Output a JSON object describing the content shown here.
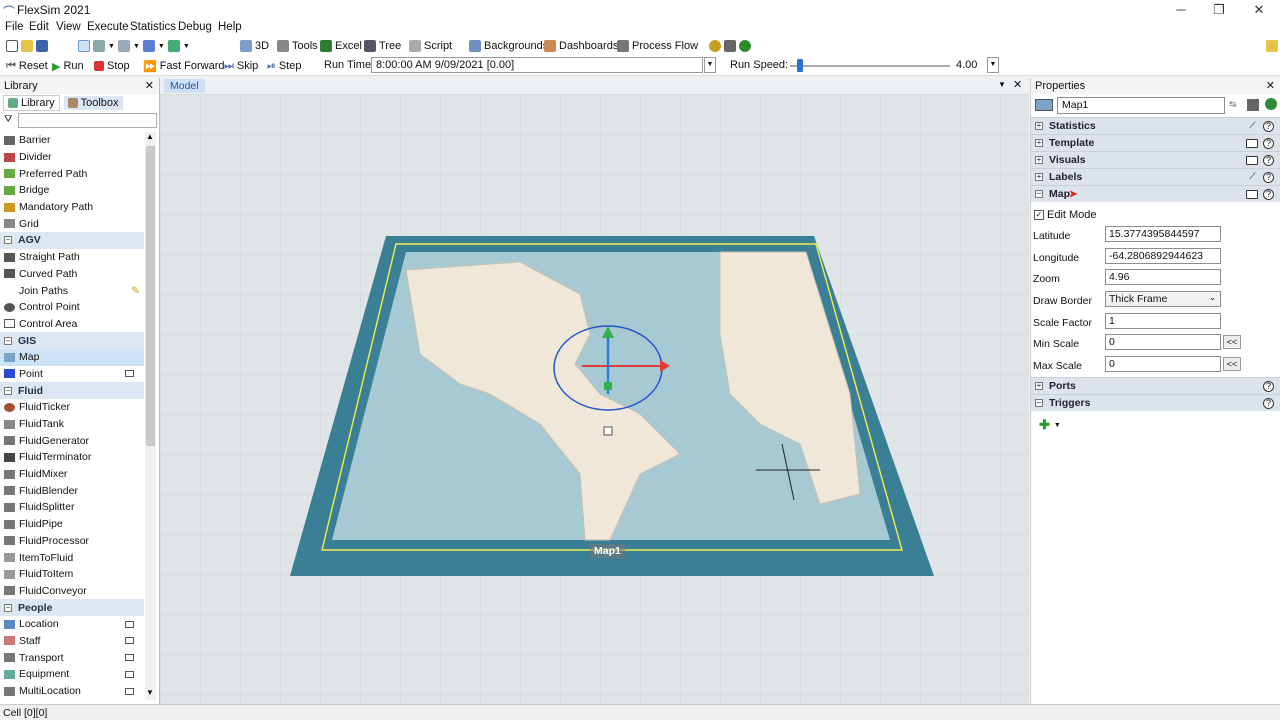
{
  "app": {
    "title": "FlexSim 2021"
  },
  "menu": [
    "File",
    "Edit",
    "View",
    "Execute",
    "Statistics",
    "Debug",
    "Help"
  ],
  "toolbar1": {
    "buttons": [
      "3D",
      "Tools",
      "Excel",
      "Tree",
      "Script",
      "Backgrounds",
      "Dashboards",
      "Process Flow"
    ]
  },
  "toolbar2": {
    "reset": "Reset",
    "run": "Run",
    "stop": "Stop",
    "fast_forward": "Fast Forward",
    "skip": "Skip",
    "step": "Step",
    "run_time_label": "Run Time:",
    "run_time_value": "8:00:00 AM  9/09/2021  [0.00]",
    "run_speed_label": "Run Speed:",
    "run_speed_value": "4.00"
  },
  "library": {
    "title": "Library",
    "tabs": [
      "Library",
      "Toolbox"
    ],
    "filter_placeholder": "",
    "items": [
      {
        "label": "Barrier",
        "color": "#666"
      },
      {
        "label": "Divider",
        "color": "#b44"
      },
      {
        "label": "Preferred Path",
        "color": "#6a4"
      },
      {
        "label": "Bridge",
        "color": "#6a4"
      },
      {
        "label": "Mandatory Path",
        "color": "#c92"
      },
      {
        "label": "Grid",
        "color": "#888"
      }
    ],
    "agv_cat": "AGV",
    "agv_items": [
      "Straight Path",
      "Curved Path",
      "Join Paths",
      "Control Point",
      "Control Area"
    ],
    "gis_cat": "GIS",
    "gis_items": [
      "Map",
      "Point"
    ],
    "fluid_cat": "Fluid",
    "fluid_items": [
      "FluidTicker",
      "FluidTank",
      "FluidGenerator",
      "FluidTerminator",
      "FluidMixer",
      "FluidBlender",
      "FluidSplitter",
      "FluidPipe",
      "FluidProcessor",
      "ItemToFluid",
      "FluidToItem",
      "FluidConveyor"
    ],
    "people_cat": "People",
    "people_items": [
      "Location",
      "Staff",
      "Transport",
      "Equipment",
      "MultiLocation"
    ]
  },
  "viewport": {
    "tab": "Model",
    "object_label": "Map1"
  },
  "properties": {
    "title": "Properties",
    "object_name": "Map1",
    "sections_top": [
      "Statistics",
      "Template",
      "Visuals",
      "Labels",
      "Map"
    ],
    "edit_mode_label": "Edit Mode",
    "fields": {
      "latitude_label": "Latitude",
      "latitude": "15.3774395844597",
      "longitude_label": "Longitude",
      "longitude": "-64.2806892944623",
      "zoom_label": "Zoom",
      "zoom": "4.96",
      "draw_border_label": "Draw Border",
      "draw_border": "Thick Frame",
      "scale_factor_label": "Scale Factor",
      "scale_factor": "1",
      "min_scale_label": "Min Scale",
      "min_scale": "0",
      "max_scale_label": "Max Scale",
      "max_scale": "0"
    },
    "sections_bottom": [
      "Ports",
      "Triggers"
    ]
  },
  "status": {
    "cell": "Cell [0][0]"
  }
}
